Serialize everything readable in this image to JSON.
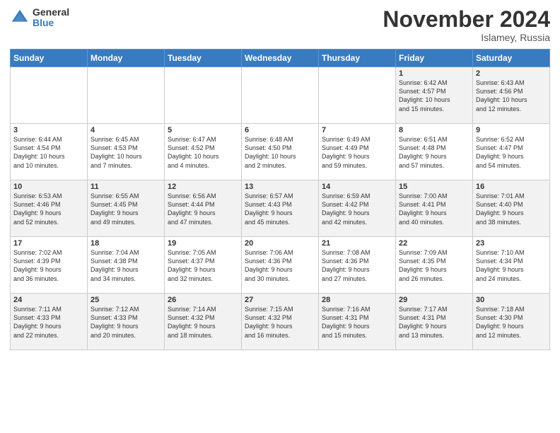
{
  "logo": {
    "general": "General",
    "blue": "Blue"
  },
  "title": "November 2024",
  "location": "Islamey, Russia",
  "days_header": [
    "Sunday",
    "Monday",
    "Tuesday",
    "Wednesday",
    "Thursday",
    "Friday",
    "Saturday"
  ],
  "weeks": [
    [
      {
        "day": "",
        "info": ""
      },
      {
        "day": "",
        "info": ""
      },
      {
        "day": "",
        "info": ""
      },
      {
        "day": "",
        "info": ""
      },
      {
        "day": "",
        "info": ""
      },
      {
        "day": "1",
        "info": "Sunrise: 6:42 AM\nSunset: 4:57 PM\nDaylight: 10 hours\nand 15 minutes."
      },
      {
        "day": "2",
        "info": "Sunrise: 6:43 AM\nSunset: 4:56 PM\nDaylight: 10 hours\nand 12 minutes."
      }
    ],
    [
      {
        "day": "3",
        "info": "Sunrise: 6:44 AM\nSunset: 4:54 PM\nDaylight: 10 hours\nand 10 minutes."
      },
      {
        "day": "4",
        "info": "Sunrise: 6:45 AM\nSunset: 4:53 PM\nDaylight: 10 hours\nand 7 minutes."
      },
      {
        "day": "5",
        "info": "Sunrise: 6:47 AM\nSunset: 4:52 PM\nDaylight: 10 hours\nand 4 minutes."
      },
      {
        "day": "6",
        "info": "Sunrise: 6:48 AM\nSunset: 4:50 PM\nDaylight: 10 hours\nand 2 minutes."
      },
      {
        "day": "7",
        "info": "Sunrise: 6:49 AM\nSunset: 4:49 PM\nDaylight: 9 hours\nand 59 minutes."
      },
      {
        "day": "8",
        "info": "Sunrise: 6:51 AM\nSunset: 4:48 PM\nDaylight: 9 hours\nand 57 minutes."
      },
      {
        "day": "9",
        "info": "Sunrise: 6:52 AM\nSunset: 4:47 PM\nDaylight: 9 hours\nand 54 minutes."
      }
    ],
    [
      {
        "day": "10",
        "info": "Sunrise: 6:53 AM\nSunset: 4:46 PM\nDaylight: 9 hours\nand 52 minutes."
      },
      {
        "day": "11",
        "info": "Sunrise: 6:55 AM\nSunset: 4:45 PM\nDaylight: 9 hours\nand 49 minutes."
      },
      {
        "day": "12",
        "info": "Sunrise: 6:56 AM\nSunset: 4:44 PM\nDaylight: 9 hours\nand 47 minutes."
      },
      {
        "day": "13",
        "info": "Sunrise: 6:57 AM\nSunset: 4:43 PM\nDaylight: 9 hours\nand 45 minutes."
      },
      {
        "day": "14",
        "info": "Sunrise: 6:59 AM\nSunset: 4:42 PM\nDaylight: 9 hours\nand 42 minutes."
      },
      {
        "day": "15",
        "info": "Sunrise: 7:00 AM\nSunset: 4:41 PM\nDaylight: 9 hours\nand 40 minutes."
      },
      {
        "day": "16",
        "info": "Sunrise: 7:01 AM\nSunset: 4:40 PM\nDaylight: 9 hours\nand 38 minutes."
      }
    ],
    [
      {
        "day": "17",
        "info": "Sunrise: 7:02 AM\nSunset: 4:39 PM\nDaylight: 9 hours\nand 36 minutes."
      },
      {
        "day": "18",
        "info": "Sunrise: 7:04 AM\nSunset: 4:38 PM\nDaylight: 9 hours\nand 34 minutes."
      },
      {
        "day": "19",
        "info": "Sunrise: 7:05 AM\nSunset: 4:37 PM\nDaylight: 9 hours\nand 32 minutes."
      },
      {
        "day": "20",
        "info": "Sunrise: 7:06 AM\nSunset: 4:36 PM\nDaylight: 9 hours\nand 30 minutes."
      },
      {
        "day": "21",
        "info": "Sunrise: 7:08 AM\nSunset: 4:36 PM\nDaylight: 9 hours\nand 27 minutes."
      },
      {
        "day": "22",
        "info": "Sunrise: 7:09 AM\nSunset: 4:35 PM\nDaylight: 9 hours\nand 26 minutes."
      },
      {
        "day": "23",
        "info": "Sunrise: 7:10 AM\nSunset: 4:34 PM\nDaylight: 9 hours\nand 24 minutes."
      }
    ],
    [
      {
        "day": "24",
        "info": "Sunrise: 7:11 AM\nSunset: 4:33 PM\nDaylight: 9 hours\nand 22 minutes."
      },
      {
        "day": "25",
        "info": "Sunrise: 7:12 AM\nSunset: 4:33 PM\nDaylight: 9 hours\nand 20 minutes."
      },
      {
        "day": "26",
        "info": "Sunrise: 7:14 AM\nSunset: 4:32 PM\nDaylight: 9 hours\nand 18 minutes."
      },
      {
        "day": "27",
        "info": "Sunrise: 7:15 AM\nSunset: 4:32 PM\nDaylight: 9 hours\nand 16 minutes."
      },
      {
        "day": "28",
        "info": "Sunrise: 7:16 AM\nSunset: 4:31 PM\nDaylight: 9 hours\nand 15 minutes."
      },
      {
        "day": "29",
        "info": "Sunrise: 7:17 AM\nSunset: 4:31 PM\nDaylight: 9 hours\nand 13 minutes."
      },
      {
        "day": "30",
        "info": "Sunrise: 7:18 AM\nSunset: 4:30 PM\nDaylight: 9 hours\nand 12 minutes."
      }
    ]
  ]
}
